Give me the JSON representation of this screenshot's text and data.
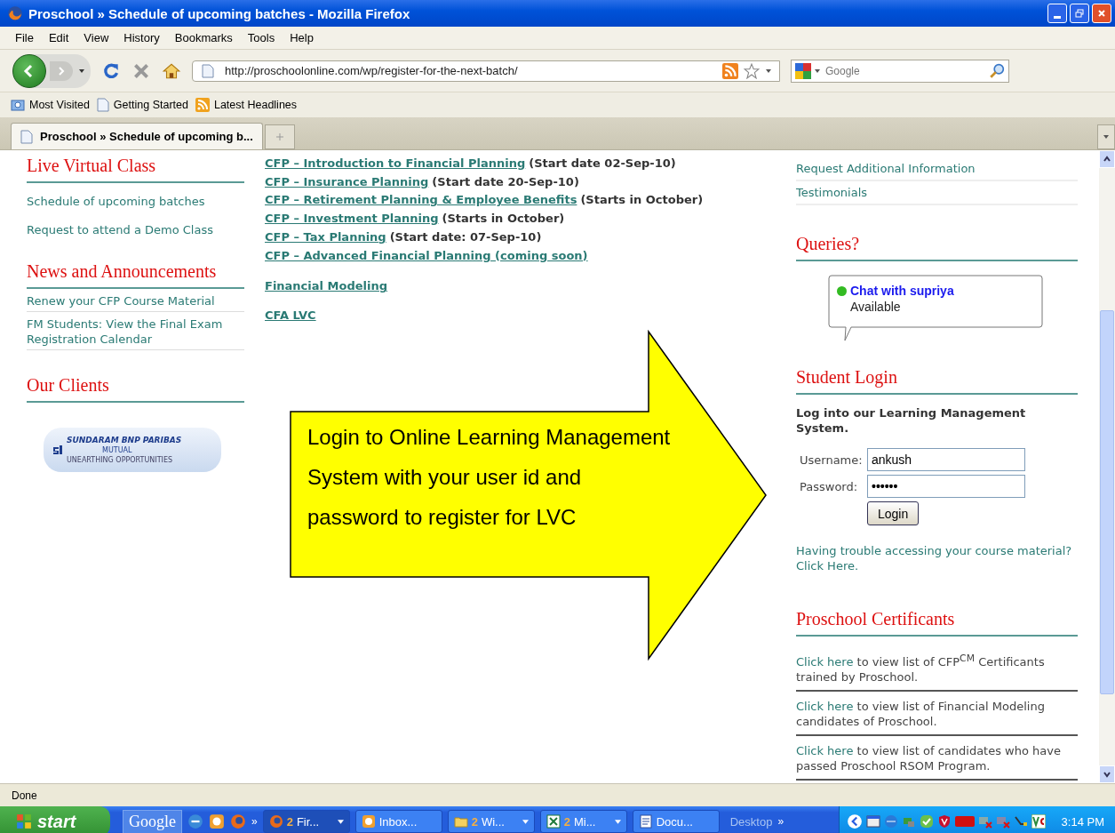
{
  "window": {
    "title": "Proschool » Schedule of upcoming batches - Mozilla Firefox"
  },
  "menu": [
    "File",
    "Edit",
    "View",
    "History",
    "Bookmarks",
    "Tools",
    "Help"
  ],
  "address_bar": {
    "value": "http://proschoolonline.com/wp/register-for-the-next-batch/"
  },
  "search": {
    "placeholder": "Google"
  },
  "bookmarks": [
    {
      "label": "Most Visited",
      "kind": "folder"
    },
    {
      "label": "Getting Started",
      "kind": "page"
    },
    {
      "label": "Latest Headlines",
      "kind": "feed"
    }
  ],
  "tabs": [
    {
      "label": "Proschool » Schedule of upcoming b...",
      "selected": true
    }
  ],
  "left": {
    "sections": [
      {
        "heading": "Live Virtual Class",
        "kind": "links",
        "items": [
          "Schedule of upcoming batches",
          "Request to attend a Demo Class"
        ]
      },
      {
        "heading": "News and Announcements",
        "kind": "news",
        "items": [
          "Renew your CFP Course Material",
          "FM Students: View the Final Exam Registration Calendar"
        ]
      },
      {
        "heading": "Our Clients",
        "kind": "logo",
        "logo": {
          "name": "SUNDARAM BNP PARIBAS",
          "sub": "MUTUAL",
          "tagline": "UNEARTHING OPPORTUNITIES"
        }
      }
    ]
  },
  "courses": [
    {
      "link": "CFP – Introduction to Financial Planning",
      "note": "(Start date 02-Sep-10)"
    },
    {
      "link": "CFP – Insurance Planning",
      "note": "(Start date 20-Sep-10)"
    },
    {
      "link": "CFP – Retirement Planning & Employee Benefits",
      "note": "(Starts in October)"
    },
    {
      "link": "CFP – Investment Planning",
      "note": "(Starts in October)"
    },
    {
      "link": "CFP – Tax Planning",
      "note": "(Start date: 07-Sep-10)"
    },
    {
      "link": "CFP – Advanced Financial Planning (coming soon)"
    }
  ],
  "other_courses": [
    "Financial Modeling",
    "CFA LVC"
  ],
  "callout": {
    "text": "Login to Online Learning Management System with your user id and password to register for LVC"
  },
  "right": {
    "links": [
      "Request Additional Information",
      "Testimonials"
    ],
    "queries": {
      "heading": "Queries?",
      "chat": {
        "label": "Chat with supriya",
        "status": "Available",
        "color": "#33bb22"
      }
    },
    "login": {
      "heading": "Student Login",
      "intro": "Log into our Learning Management System.",
      "username_label": "Username:",
      "username": "ankush",
      "password_label": "Password:",
      "password": "••••••",
      "button": "Login",
      "help": "Having trouble accessing your course material? Click Here."
    },
    "certificants": {
      "heading": "Proschool Certificants",
      "items": [
        {
          "link": "Click here",
          "text": "to view list of CFP$^{CM}$ Certificants trained by Proschool."
        },
        {
          "link": "Click here",
          "text": "to view list of Financial Modeling candidates of Proschool."
        },
        {
          "link": "Click here",
          "text": "to view list of candidates who have passed Proschool RSOM Program."
        }
      ]
    }
  },
  "status_bar": "Done",
  "taskbar": {
    "start": "start",
    "deskbar": "Google",
    "more": "»",
    "tasks": [
      {
        "count": "2",
        "label": "Fir...",
        "kind": "firefox",
        "selected": true,
        "group": true
      },
      {
        "label": "Inbox...",
        "kind": "mail",
        "selected": false,
        "group": false
      },
      {
        "count": "2",
        "label": "Wi...",
        "kind": "folder",
        "selected": false,
        "group": true
      },
      {
        "count": "2",
        "label": "Mi...",
        "kind": "excel",
        "selected": false,
        "group": true
      },
      {
        "label": "Docu...",
        "kind": "word",
        "selected": false,
        "group": false
      }
    ],
    "desktop": "Desktop",
    "clock": "3:14 PM"
  }
}
